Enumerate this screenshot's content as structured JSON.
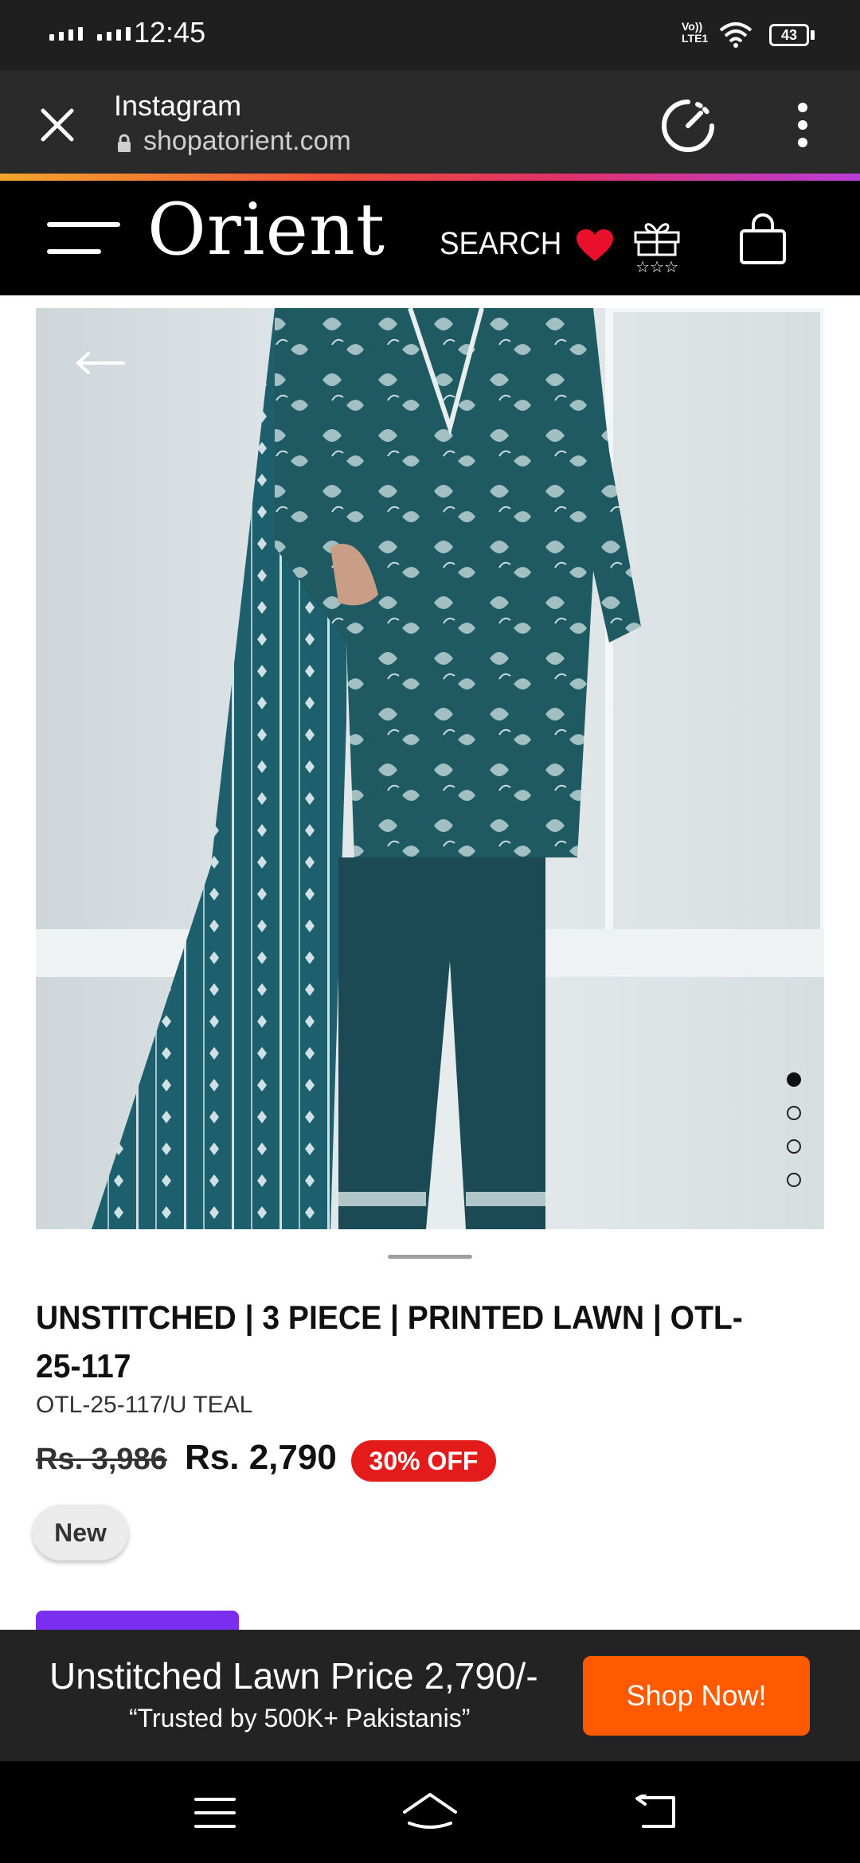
{
  "status_bar": {
    "time": "12:45",
    "network_label": "Vo)) LTE1",
    "battery": "43",
    "icons": [
      "signal-icon",
      "signal-icon",
      "volte-icon",
      "wifi-icon",
      "battery-icon"
    ]
  },
  "browser": {
    "source_app": "Instagram",
    "url": "shopatorient.com",
    "icons": [
      "close-icon",
      "lock-icon",
      "speedometer-icon",
      "more-vertical-icon"
    ]
  },
  "site_header": {
    "logo": "Orient",
    "search_label": "SEARCH",
    "icons": [
      "menu-icon",
      "heart-icon",
      "gift-icon",
      "shopping-bag-icon"
    ],
    "heart_color": "#e8102a"
  },
  "gallery": {
    "slide_count": 4,
    "active_slide": 1,
    "icons": [
      "back-arrow-icon"
    ]
  },
  "product": {
    "title": "UNSTITCHED | 3 PIECE | PRINTED LAWN | OTL-25-117",
    "sku": "OTL-25-117/U TEAL",
    "old_price": "Rs. 3,986",
    "price": "Rs. 2,790",
    "discount": "30% OFF",
    "tag": "New",
    "discount_color": "#e41b1b"
  },
  "promo": {
    "title": "Unstitched Lawn Price 2,790/-",
    "subtitle": "“Trusted by 500K+ Pakistanis”",
    "cta": "Shop Now!",
    "cta_color": "#ff5a00"
  },
  "nav_bar": {
    "icons": [
      "menu-lines-icon",
      "home-icon",
      "back-icon"
    ]
  }
}
